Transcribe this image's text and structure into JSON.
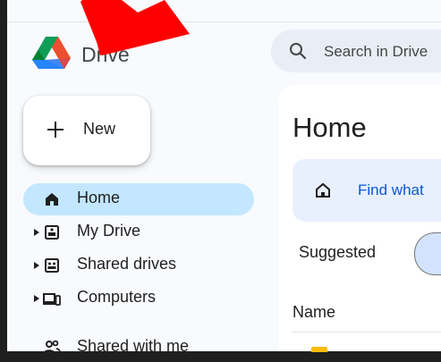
{
  "app": {
    "wordmark": "Drive"
  },
  "search": {
    "placeholder": "Search in Drive"
  },
  "new_button": {
    "label": "New"
  },
  "sidebar": {
    "items": [
      {
        "label": "Home",
        "icon": "home-icon",
        "active": true
      },
      {
        "label": "My Drive",
        "icon": "my-drive-icon"
      },
      {
        "label": "Shared drives",
        "icon": "shared-drives-icon"
      },
      {
        "label": "Computers",
        "icon": "computers-icon"
      },
      {
        "label": "Shared with me",
        "icon": "shared-with-me-icon"
      }
    ]
  },
  "main": {
    "title": "Home",
    "banner_text": "Find what",
    "suggested_label": "Suggested",
    "name_column": "Name"
  },
  "colors": {
    "active_nav": "#c2e7ff",
    "banner_bg": "#e8f0fe",
    "banner_text": "#0b57d0",
    "annotation_arrow": "#ff0000"
  }
}
